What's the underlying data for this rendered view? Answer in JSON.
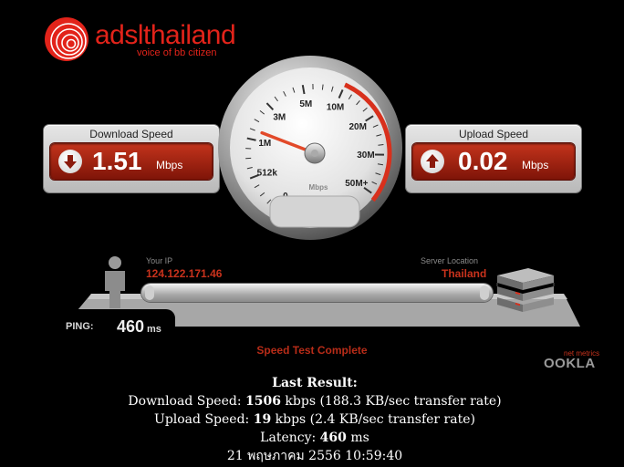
{
  "logo": {
    "name": "adslthailand",
    "tagline": "voice of bb citizen",
    "color": "#e2231a"
  },
  "download": {
    "title": "Download Speed",
    "value": "1.51",
    "unit": "Mbps"
  },
  "upload": {
    "title": "Upload Speed",
    "value": "0.02",
    "unit": "Mbps"
  },
  "gauge": {
    "tick_labels": [
      "0",
      "512k",
      "1M",
      "3M",
      "5M",
      "10M",
      "20M",
      "30M",
      "50M+"
    ],
    "unit": "Mbps",
    "needle_value": "1.51 Mbps",
    "accent_color": "#d8301c"
  },
  "connection": {
    "ip_label": "Your IP",
    "ip_value": "124.122.171.46",
    "server_label": "Server Location",
    "server_value": "Thailand"
  },
  "ping": {
    "label": "PING:",
    "value": "460",
    "unit": "ms"
  },
  "status": "Speed Test Complete",
  "brand": {
    "small": "net metrics",
    "name": "OOKLA"
  },
  "results": {
    "title": "Last Result:",
    "download_prefix": "Download Speed: ",
    "download_value": "1506",
    "download_suffix": " kbps (188.3 KB/sec transfer rate)",
    "upload_prefix": "Upload Speed: ",
    "upload_value": "19",
    "upload_suffix": " kbps (2.4 KB/sec transfer rate)",
    "latency_prefix": "Latency: ",
    "latency_value": "460",
    "latency_suffix": " ms",
    "timestamp": "21 พฤษภาคม 2556 10:59:40"
  }
}
